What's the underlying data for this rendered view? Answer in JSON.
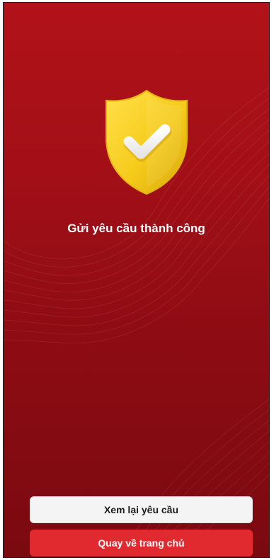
{
  "status": {
    "title": "Gửi yêu cầu thành công",
    "icon": "shield-check-icon",
    "icon_color": "#f6cc1c"
  },
  "actions": {
    "review_label": "Xem lại yêu cầu",
    "home_label": "Quay về trang chủ"
  },
  "colors": {
    "background": "#a30f17",
    "primary_button": "#e12a2f",
    "secondary_button": "#f4f4f4"
  }
}
